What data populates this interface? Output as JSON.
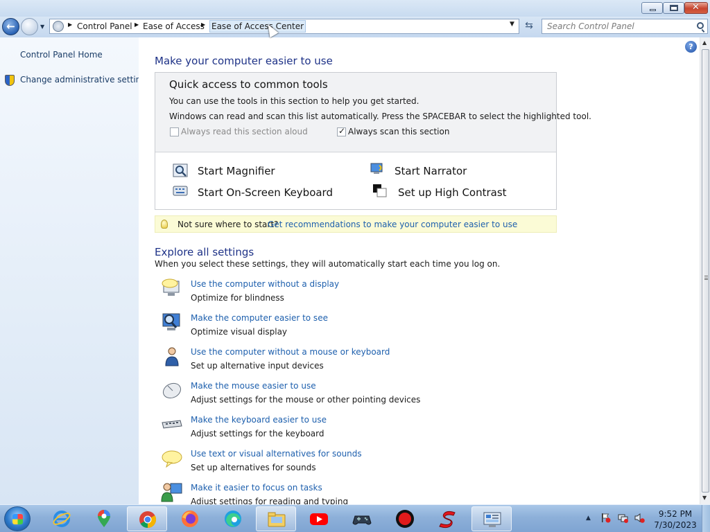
{
  "window": {
    "minimize_icon": "minimize-icon",
    "maximize_icon": "restore-icon",
    "close_glyph": "✕"
  },
  "nav": {
    "back_glyph": "←",
    "breadcrumbs": [
      "Control Panel",
      "Ease of Access",
      "Ease of Access Center"
    ],
    "refresh_glyph": "⇆",
    "search_placeholder": "Search Control Panel"
  },
  "sidebar": {
    "items": [
      {
        "label": "Control Panel Home"
      },
      {
        "label": "Change administrative settings"
      }
    ]
  },
  "main": {
    "help_glyph": "?",
    "title": "Make your computer easier to use",
    "quick": {
      "title": "Quick access to common tools",
      "line1": "You can use the tools in this section to help you get started.",
      "line2": "Windows can read and scan this list automatically.  Press the SPACEBAR to select the highlighted tool.",
      "read_aloud": {
        "label": "Always read this section aloud",
        "checked": false
      },
      "scan": {
        "label": "Always scan this section",
        "checked": true
      },
      "tools": [
        "Start Magnifier",
        "Start Narrator",
        "Start On-Screen Keyboard",
        "Set up High Contrast"
      ]
    },
    "tip": {
      "text": "Not sure where to start?",
      "link": "Get recommendations to make your computer easier to use"
    },
    "explore": {
      "title": "Explore all settings",
      "description": "When you select these settings, they will automatically start each time you log on.",
      "items": [
        {
          "link": "Use the computer without a display",
          "desc": "Optimize for blindness"
        },
        {
          "link": "Make the computer easier to see",
          "desc": "Optimize visual display"
        },
        {
          "link": "Use the computer without a mouse or keyboard",
          "desc": "Set up alternative input devices"
        },
        {
          "link": "Make the mouse easier to use",
          "desc": "Adjust settings for the mouse or other pointing devices"
        },
        {
          "link": "Make the keyboard easier to use",
          "desc": "Adjust settings for the keyboard"
        },
        {
          "link": "Use text or visual alternatives for sounds",
          "desc": "Set up alternatives for sounds"
        },
        {
          "link": "Make it easier to focus on tasks",
          "desc": "Adjust settings for reading and typing"
        }
      ]
    }
  },
  "taskbar": {
    "apps": [
      "internet-explorer",
      "maps",
      "chrome",
      "firefox",
      "edge",
      "file-explorer",
      "youtube",
      "game-controller",
      "screen-recorder",
      "s-app",
      "control-panel"
    ],
    "time": "9:52 PM",
    "date": "7/30/2023"
  },
  "colors": {
    "link": "#1d5fad",
    "heading": "#1e3287",
    "tip_background": "#fbfbd6"
  }
}
